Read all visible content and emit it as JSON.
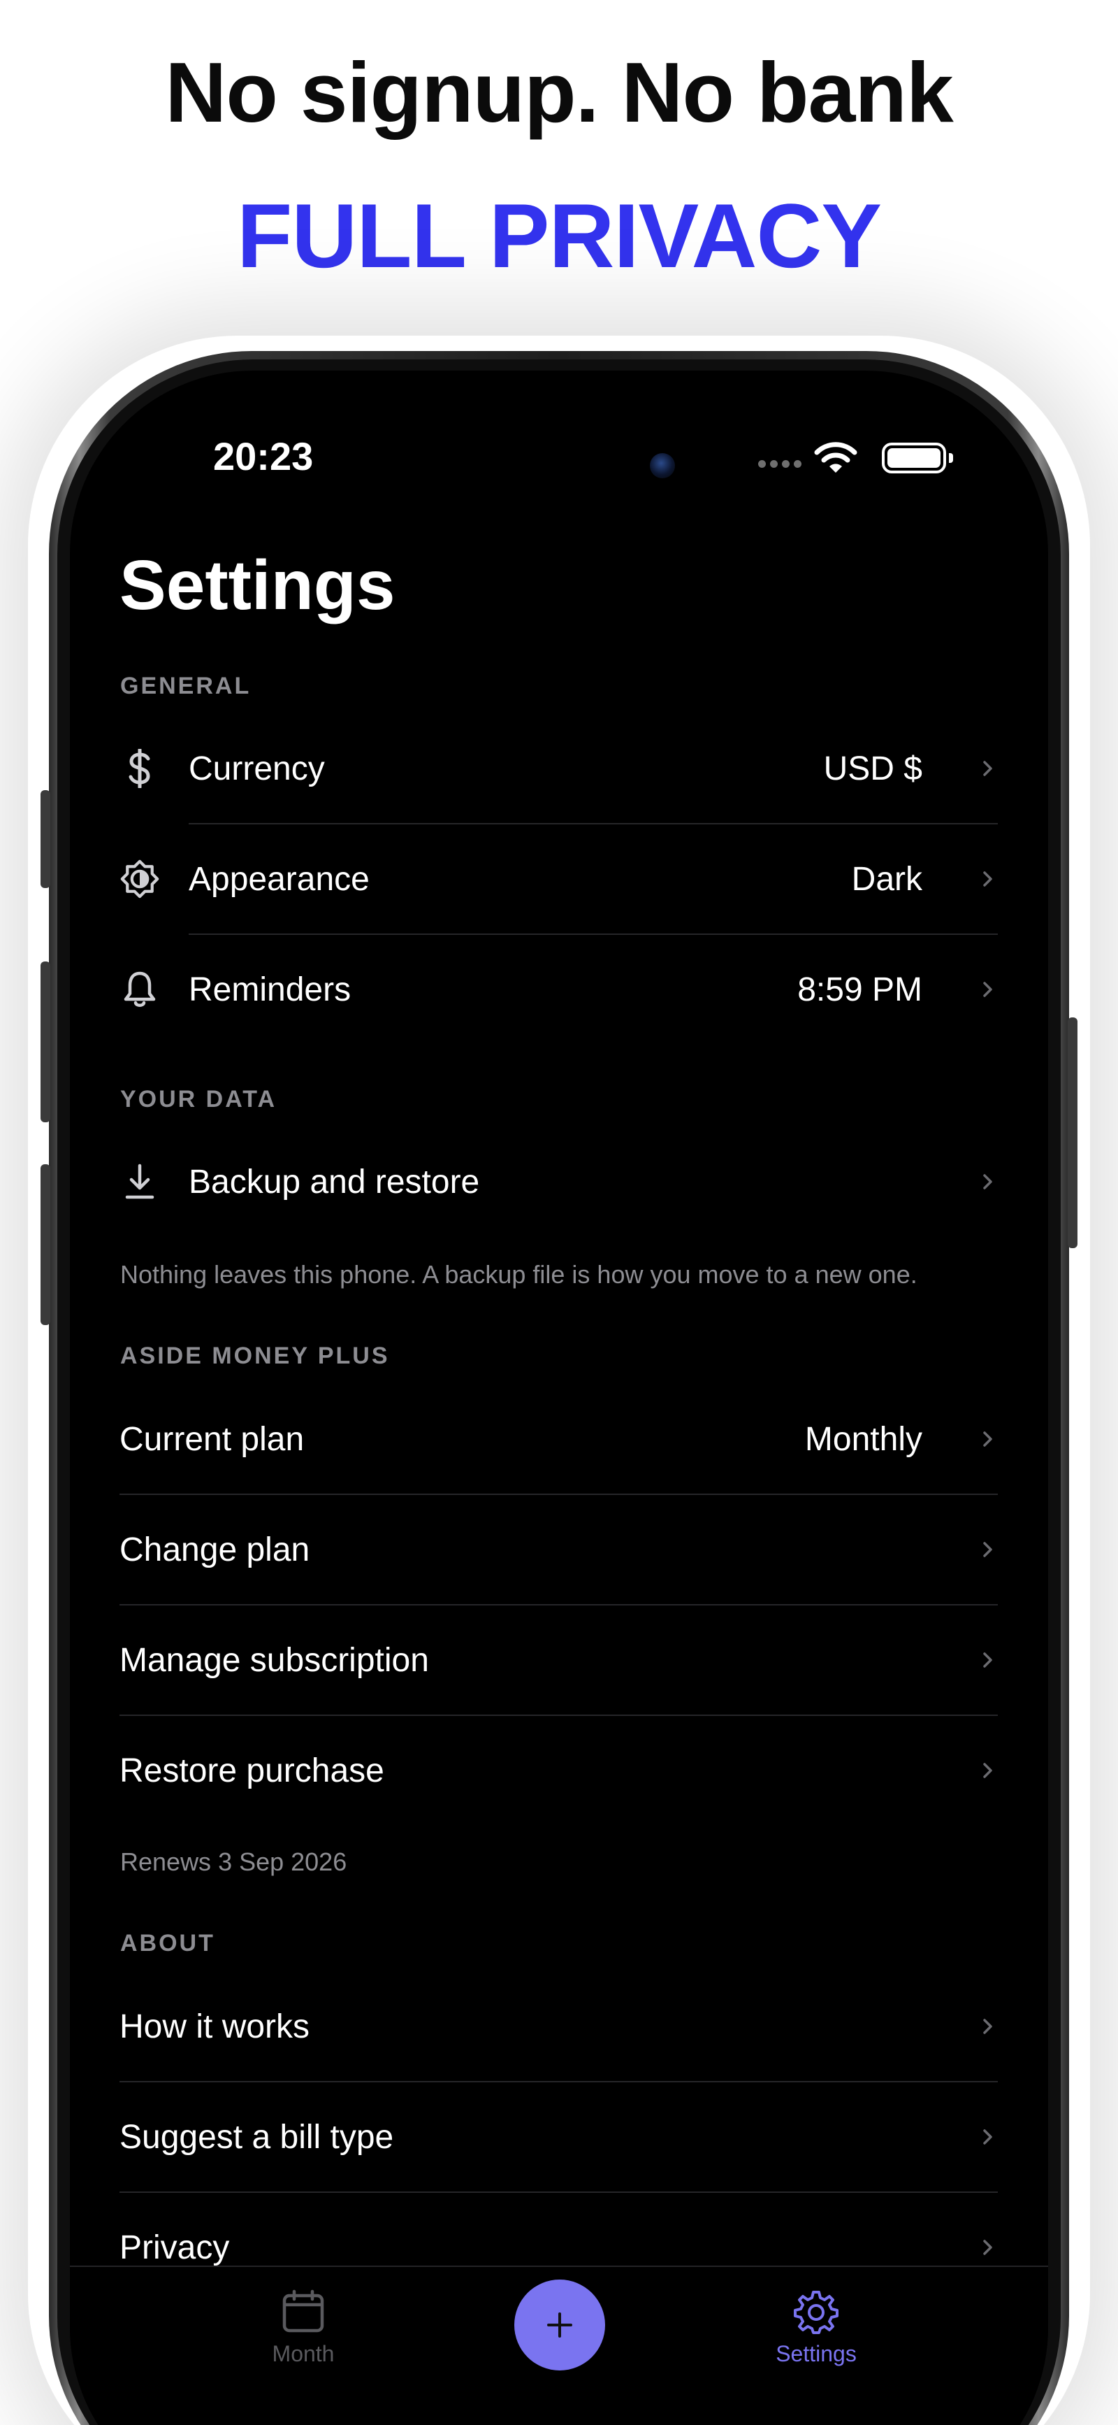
{
  "marketing": {
    "headline": "No signup. No bank",
    "subhead": "FULL PRIVACY"
  },
  "status_bar": {
    "time": "20:23"
  },
  "page": {
    "title": "Settings"
  },
  "general": {
    "header": "GENERAL",
    "items": [
      {
        "icon": "dollar-icon",
        "label": "Currency",
        "value": "USD $"
      },
      {
        "icon": "appearance-icon",
        "label": "Appearance",
        "value": "Dark"
      },
      {
        "icon": "bell-icon",
        "label": "Reminders",
        "value": "8:59 PM"
      }
    ]
  },
  "your_data": {
    "header": "YOUR DATA",
    "items": [
      {
        "icon": "download-icon",
        "label": "Backup and restore",
        "value": ""
      }
    ],
    "footnote": "Nothing leaves this phone. A backup file is how you move to a new one."
  },
  "plus": {
    "header": "ASIDE MONEY PLUS",
    "items": [
      {
        "label": "Current plan",
        "value": "Monthly"
      },
      {
        "label": "Change plan",
        "value": ""
      },
      {
        "label": "Manage subscription",
        "value": ""
      },
      {
        "label": "Restore purchase",
        "value": ""
      }
    ],
    "footnote": "Renews 3 Sep 2026"
  },
  "about": {
    "header": "ABOUT",
    "items": [
      {
        "label": "How it works"
      },
      {
        "label": "Suggest a bill type"
      },
      {
        "label": "Privacy"
      }
    ]
  },
  "tabbar": {
    "tabs": [
      {
        "label": "Month",
        "icon": "calendar-icon",
        "active": false
      },
      {
        "label": "Settings",
        "icon": "gear-icon",
        "active": true
      }
    ],
    "add_icon": "plus-icon"
  },
  "colors": {
    "accent": "#3333ee",
    "tab_active": "#7a74f0",
    "tab_inactive": "#5a5a5e",
    "fab": "#7a74f0"
  }
}
